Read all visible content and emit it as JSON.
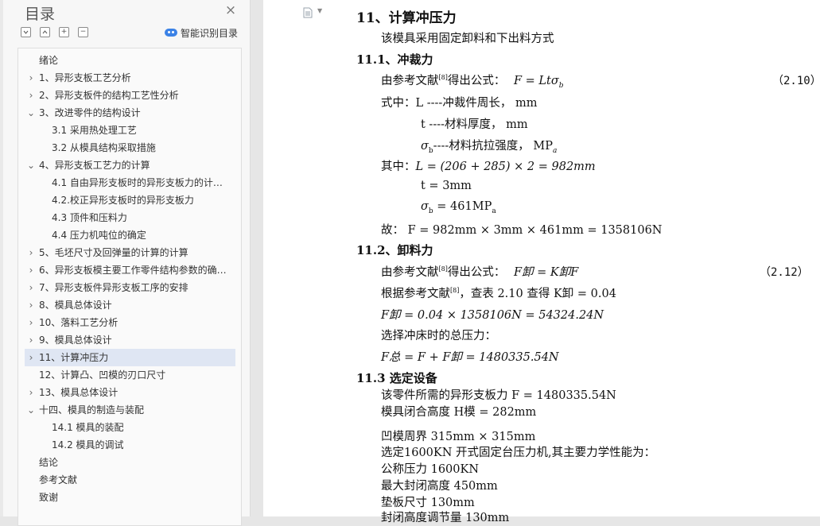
{
  "toc": {
    "title": "目录",
    "close_glyph": "×",
    "tools": {
      "expand": "+",
      "collapse": "−",
      "smart_toc": "智能识别目录"
    },
    "items": [
      {
        "label": "绪论",
        "level": 1,
        "chevron": "",
        "selected": false
      },
      {
        "label": "1、异形支板工艺分析",
        "level": 1,
        "chevron": "›",
        "selected": false
      },
      {
        "label": "2、异形支板件的结构工艺性分析",
        "level": 1,
        "chevron": "›",
        "selected": false
      },
      {
        "label": "3、改进零件的结构设计",
        "level": 1,
        "chevron": "⌄",
        "selected": false
      },
      {
        "label": "3.1 采用热处理工艺",
        "level": 2,
        "chevron": "",
        "selected": false
      },
      {
        "label": "3.2 从模具结构采取措施",
        "level": 2,
        "chevron": "",
        "selected": false
      },
      {
        "label": "4、异形支板工艺力的计算",
        "level": 1,
        "chevron": "⌄",
        "selected": false
      },
      {
        "label": "4.1 自由异形支板时的异形支板力的计…",
        "level": 2,
        "chevron": "",
        "selected": false
      },
      {
        "label": "4.2.校正异形支板时的异形支板力",
        "level": 2,
        "chevron": "",
        "selected": false
      },
      {
        "label": "4.3 顶件和压料力",
        "level": 2,
        "chevron": "",
        "selected": false
      },
      {
        "label": "4.4 压力机吨位的确定",
        "level": 2,
        "chevron": "",
        "selected": false
      },
      {
        "label": "5、毛坯尺寸及回弹量的计算的计算",
        "level": 1,
        "chevron": "›",
        "selected": false
      },
      {
        "label": "6、异形支板模主要工作零件结构参数的确…",
        "level": 1,
        "chevron": "›",
        "selected": false
      },
      {
        "label": "7、异形支板件异形支板工序的安排",
        "level": 1,
        "chevron": "›",
        "selected": false
      },
      {
        "label": "8、模具总体设计",
        "level": 1,
        "chevron": "›",
        "selected": false
      },
      {
        "label": "10、落料工艺分析",
        "level": 1,
        "chevron": "›",
        "selected": false
      },
      {
        "label": "9、模具总体设计",
        "level": 1,
        "chevron": "›",
        "selected": false
      },
      {
        "label": "11、计算冲压力",
        "level": 1,
        "chevron": "›",
        "selected": true
      },
      {
        "label": "12、计算凸、凹模的刃口尺寸",
        "level": 1,
        "chevron": "",
        "selected": false
      },
      {
        "label": "13、模具总体设计",
        "level": 1,
        "chevron": "›",
        "selected": false
      },
      {
        "label": "十四、模具的制造与装配",
        "level": 1,
        "chevron": "⌄",
        "selected": false
      },
      {
        "label": "14.1 模具的装配",
        "level": 2,
        "chevron": "",
        "selected": false
      },
      {
        "label": "14.2  模具的调试",
        "level": 2,
        "chevron": "",
        "selected": false
      },
      {
        "label": "结论",
        "level": 1,
        "chevron": "",
        "selected": false
      },
      {
        "label": "参考文献",
        "level": 1,
        "chevron": "",
        "selected": false
      },
      {
        "label": "致谢",
        "level": 1,
        "chevron": "",
        "selected": false
      }
    ]
  },
  "doc": {
    "page_icon": "document-icon",
    "h_main": "11、计算冲压力",
    "intro": "该模具采用固定卸料和下出料方式",
    "h_111": "11.1、冲裁力",
    "ref1_prefix": "由参考文献",
    "ref_mark": "[8]",
    "ref1_suffix": "得出公式：",
    "formula1": "F = Ltσ",
    "formula1_sub": "b",
    "eq1": "（2.10）",
    "where1_prefix": "式中：",
    "where1": "L ----冲裁件周长， mm",
    "where2": "t ----材料厚度，  mm",
    "where3_sym": "σ",
    "where3_sub": "b",
    "where3": "----材料抗拉强度，  MP",
    "where3_unit_sub": "a",
    "among_prefix": "其中：",
    "calc_L": "L = (206 + 285) × 2 = 982mm",
    "calc_t": "t = 3mm",
    "calc_sigma": "= 461MP",
    "calc_sigma_sub": "a",
    "result_F": "故：  F = 982mm × 3mm × 461mm = 1358106N",
    "h_112": "11.2、卸料力",
    "ref2_prefix": "由参考文献",
    "ref2_suffix": "得出公式：",
    "formula2": "F卸 = K卸F",
    "eq2": "（2.12）",
    "table_prefix": "根据参考文献",
    "table_suffix": "，查表 2.10 查得 K卸 = 0.04",
    "calc_Fx": "F卸 = 0.04 × 1358106N = 54324.24N",
    "select_press": "选择冲床时的总压力：",
    "total": "F总 = F + F卸 = 1480335.54N",
    "h_113": "11.3 选定设备",
    "part_force": "该零件所需的异形支板力    F = 1480335.54N",
    "closed_height": "模具闭合高度 H模  = 282mm",
    "die_perim": "凹模周界      315mm × 315mm",
    "select_1600": "选定1600KN 开式固定台压力机,其主要力学性能为：",
    "nominal": "公称压力         1600KN",
    "max_closed": "最大封闭高度      450mm",
    "pad_size": "垫板尺寸       130mm",
    "cutoff": "封闭高度调节量    130mm"
  }
}
